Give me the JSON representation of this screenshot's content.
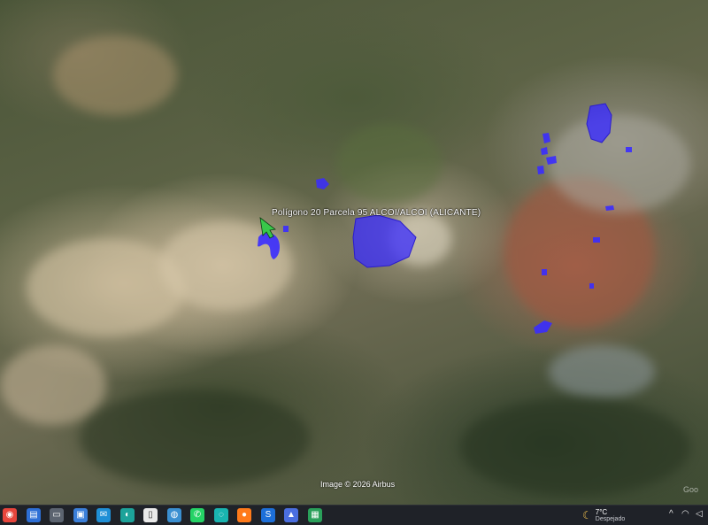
{
  "map": {
    "placemark_label": "Polígono 20 Parcela 95 ALCOI/ALCOI (ALICANTE)",
    "attribution": "Image © 2026 Airbus",
    "watermark": "Goo",
    "overlay_color": "#3a2cff",
    "arrow_color": "#39c84a"
  },
  "taskbar": {
    "apps": [
      {
        "name": "chrome-icon",
        "glyph": "◉",
        "color": "#e8453c"
      },
      {
        "name": "document-icon",
        "glyph": "▤",
        "color": "#2d6fd6"
      },
      {
        "name": "window-icon",
        "glyph": "▭",
        "color": "#5c6470"
      },
      {
        "name": "folder-share-icon",
        "glyph": "▣",
        "color": "#3b7fd9"
      },
      {
        "name": "mail-icon",
        "glyph": "✉",
        "color": "#1f8fd6"
      },
      {
        "name": "edge-icon",
        "glyph": "◐",
        "color": "#1ca39a"
      },
      {
        "name": "file-icon",
        "glyph": "▯",
        "color": "#e9e9e9"
      },
      {
        "name": "earth-icon",
        "glyph": "◍",
        "color": "#3a8fd1"
      },
      {
        "name": "whatsapp-icon",
        "glyph": "✆",
        "color": "#25d366"
      },
      {
        "name": "wave-icon",
        "glyph": "◌",
        "color": "#19b4b0"
      },
      {
        "name": "firefox-icon",
        "glyph": "●",
        "color": "#ff7a1a"
      },
      {
        "name": "s-app-icon",
        "glyph": "S",
        "color": "#1d6fd9"
      },
      {
        "name": "arrow-app-icon",
        "glyph": "▲",
        "color": "#4a6ee0"
      },
      {
        "name": "spreadsheet-icon",
        "glyph": "▦",
        "color": "#2aa05a"
      }
    ],
    "weather": {
      "temperature": "7°C",
      "condition": "Despejado",
      "icon": "moon-icon"
    },
    "tray": {
      "chevron": "^",
      "wifi": "◠",
      "volume": "◁"
    }
  }
}
